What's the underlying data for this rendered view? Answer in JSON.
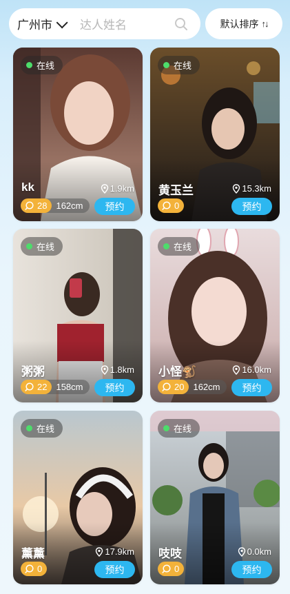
{
  "search": {
    "city": "广州市",
    "placeholder": "达人姓名",
    "sort_label": "默认排序"
  },
  "online_label": "在线",
  "book_label": "预约",
  "cards": [
    {
      "name": "kk",
      "distance": "1.9km",
      "count": "28",
      "height": "162cm"
    },
    {
      "name": "黄玉兰",
      "distance": "15.3km",
      "count": "0",
      "height": ""
    },
    {
      "name": "粥粥",
      "distance": "1.8km",
      "count": "22",
      "height": "158cm"
    },
    {
      "name": "小怪🐒",
      "distance": "16.0km",
      "count": "20",
      "height": "162cm"
    },
    {
      "name": "薰薰",
      "distance": "17.9km",
      "count": "0",
      "height": ""
    },
    {
      "name": "吱吱",
      "distance": "0.0km",
      "count": "0",
      "height": ""
    }
  ],
  "colors": {
    "accent": "#2db7f0",
    "count_badge": "#f3b23a",
    "online_dot": "#4ddc6b"
  }
}
